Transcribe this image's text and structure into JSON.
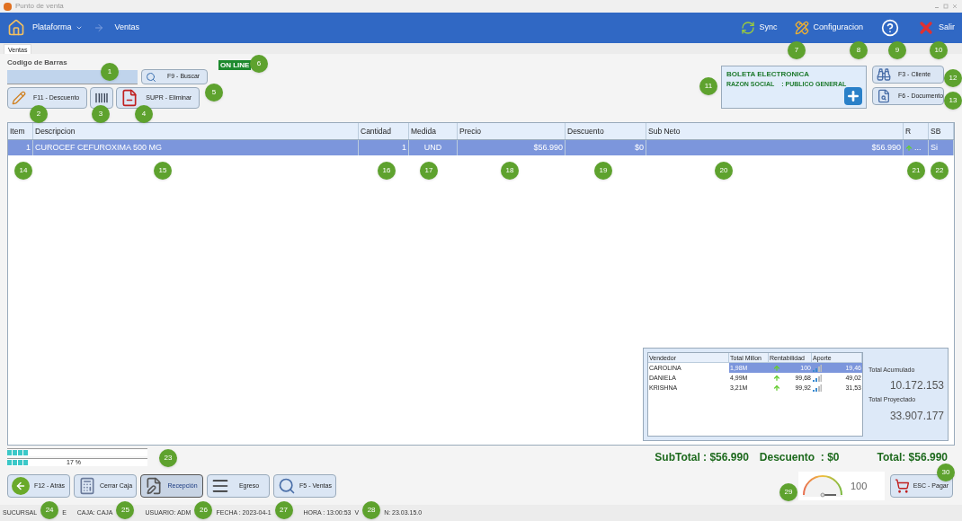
{
  "window": {
    "title": "Punto de venta"
  },
  "nav": {
    "menu": "Plataforma",
    "current": "Ventas"
  },
  "actions": [
    {
      "kind": "sync",
      "label": "Sync"
    },
    {
      "kind": "config",
      "label": "Configuracion"
    },
    {
      "kind": "help"
    },
    {
      "kind": "exit",
      "label": "Salir"
    }
  ],
  "tab": "Ventas",
  "barcode": {
    "label": "Codigo de Barras"
  },
  "search_button": "F9 - Buscar",
  "online_badge": "ON LINE",
  "tools": [
    {
      "kind": "discount",
      "label": "F11 - Descuento"
    },
    {
      "kind": "barcode"
    },
    {
      "kind": "delete",
      "label": "SUPR - Eliminar"
    }
  ],
  "document": {
    "title": "BOLETA ELECTRONICA",
    "field": "RAZON SOCIAL",
    "value": ": PUBLICO GENERAL"
  },
  "side_buttons": [
    {
      "kind": "client",
      "label": "F3 - Cliente"
    },
    {
      "kind": "document",
      "label": "F6 - Documento"
    }
  ],
  "table": {
    "columns": [
      "Item",
      "Descripcion",
      "Cantidad",
      "Medida",
      "Precio",
      "Descuento",
      "Sub Neto",
      "R",
      "SB"
    ],
    "rows": [
      {
        "selected": true,
        "cells": [
          "1",
          "CUROCEF CEFUROXIMA 500 MG",
          "1",
          "UND",
          "$56.990",
          "$0",
          "$56.990",
          "...",
          "Si"
        ]
      }
    ]
  },
  "sellers": {
    "columns": [
      "Vendedor",
      "Total Millon",
      "Rentabilidad",
      "Aporte"
    ],
    "rows": [
      {
        "selected": true,
        "name": "CAROLINA",
        "total": "1,98M",
        "rent": "100",
        "aporte": "19,46"
      },
      {
        "selected": false,
        "name": "DANIELA",
        "total": "4,99M",
        "rent": "99,68",
        "aporte": "49,02"
      },
      {
        "selected": false,
        "name": "KRISHNA",
        "total": "3,21M",
        "rent": "99,92",
        "aporte": "31,53"
      }
    ],
    "acc_label": "Total Acumulado",
    "acc_value": "10.172.153",
    "proj_label": "Total Proyectado",
    "proj_value": "33.907.177"
  },
  "progress": [
    {
      "level": 0.15
    },
    {
      "level": 0.15,
      "reading": "17 %"
    }
  ],
  "totals": {
    "subtotal": "SubTotal : $56.990",
    "discount": "Descuento  : $0",
    "total": "Total: $56.990"
  },
  "bottom_buttons": [
    {
      "kind": "back",
      "label": "F12 - Atrás",
      "selected": false
    },
    {
      "kind": "close",
      "label": "Cerrar Caja",
      "selected": false
    },
    {
      "kind": "reception",
      "label": "Recepción",
      "selected": true
    },
    {
      "kind": "egress",
      "label": "Egreso",
      "selected": false
    },
    {
      "kind": "sales",
      "label": "F5 - Ventas",
      "selected": false
    }
  ],
  "gauge": {
    "level": 1,
    "reading": "100"
  },
  "pay_button": "ESC - Pagar",
  "status_bar": [
    "SUCURSAL",
    "E",
    "CAJA: CAJA",
    "USUARIO: ADM",
    "FECHA : 2023-04-1",
    "HORA : 13:00:53",
    "V",
    "N: 23.03.15.0"
  ],
  "callouts": [
    "1",
    "2",
    "3",
    "4",
    "5",
    "6",
    "7",
    "8",
    "9",
    "10",
    "11",
    "12",
    "13",
    "14",
    "15",
    "16",
    "17",
    "18",
    "19",
    "20",
    "21",
    "22",
    "23",
    "24",
    "25",
    "26",
    "27",
    "28",
    "29",
    "30"
  ]
}
